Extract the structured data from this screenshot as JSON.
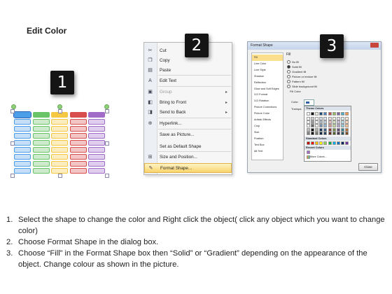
{
  "page": {
    "title": "Edit Color"
  },
  "badges": [
    "1",
    "2",
    "3"
  ],
  "table_shape": {
    "columns": [
      "#4d9ee8",
      "#69c367",
      "#f4c843",
      "#d84d4d",
      "#a06cc8"
    ],
    "rows": 9
  },
  "context_menu": {
    "items": [
      {
        "label": "Cut",
        "icon": "scissors-icon",
        "glyph": "✂",
        "disabled": false,
        "submenu": false,
        "highlighted": false
      },
      {
        "label": "Copy",
        "icon": "copy-icon",
        "glyph": "❐",
        "disabled": false,
        "submenu": false,
        "highlighted": false
      },
      {
        "label": "Paste",
        "icon": "paste-icon",
        "glyph": "▤",
        "disabled": false,
        "submenu": false,
        "highlighted": false
      },
      {
        "label": "Edit Text",
        "icon": "edit-text-icon",
        "glyph": "A",
        "disabled": false,
        "submenu": false,
        "highlighted": false
      },
      {
        "label": "Group",
        "icon": "group-icon",
        "glyph": "▣",
        "disabled": true,
        "submenu": true,
        "highlighted": false
      },
      {
        "label": "Bring to Front",
        "icon": "bring-to-front-icon",
        "glyph": "◧",
        "disabled": false,
        "submenu": true,
        "highlighted": false
      },
      {
        "label": "Send to Back",
        "icon": "send-to-back-icon",
        "glyph": "◨",
        "disabled": false,
        "submenu": true,
        "highlighted": false
      },
      {
        "label": "Hyperlink...",
        "icon": "hyperlink-icon",
        "glyph": "⊕",
        "disabled": false,
        "submenu": false,
        "highlighted": false
      },
      {
        "label": "Save as Picture...",
        "icon": "",
        "glyph": "",
        "disabled": false,
        "submenu": false,
        "highlighted": false
      },
      {
        "label": "Set as Default Shape",
        "icon": "",
        "glyph": "",
        "disabled": false,
        "submenu": false,
        "highlighted": false
      },
      {
        "label": "Size and Position...",
        "icon": "size-position-icon",
        "glyph": "⊞",
        "disabled": false,
        "submenu": false,
        "highlighted": false
      },
      {
        "label": "Format Shape...",
        "icon": "format-shape-icon",
        "glyph": "✎",
        "disabled": false,
        "submenu": false,
        "highlighted": true
      }
    ]
  },
  "format_dialog": {
    "title": "Format Shape",
    "nav": [
      "Fill",
      "Line Color",
      "Line Style",
      "Shadow",
      "Reflection",
      "Glow and Soft Edges",
      "3-D Format",
      "3-D Rotation",
      "Picture Corrections",
      "Picture Color",
      "Artistic Effects",
      "Crop",
      "Size",
      "Position",
      "Text Box",
      "Alt Text"
    ],
    "selected_nav": "Fill",
    "section_title": "Fill",
    "options": [
      {
        "label": "No fill",
        "selected": false
      },
      {
        "label": "Solid fill",
        "selected": true
      },
      {
        "label": "Gradient fill",
        "selected": false
      },
      {
        "label": "Picture or texture fill",
        "selected": false
      },
      {
        "label": "Pattern fill",
        "selected": false
      },
      {
        "label": "Slide background fill",
        "selected": false
      }
    ],
    "fill_color_label": "Fill Color",
    "color_label": "Color:",
    "transparency_label": "Transpa",
    "theme_colors_label": "Theme Colors",
    "standard_colors_label": "Standard Colors",
    "recent_colors_label": "Recent Colors",
    "more_colors_label": "More Colors...",
    "close_label": "Close",
    "theme_top_row": [
      "#ffffff",
      "#000000",
      "#eeece1",
      "#1f497d",
      "#4f81bd",
      "#c0504d",
      "#9bbb59",
      "#8064a2",
      "#4bacc6",
      "#f79646"
    ],
    "standard_colors": [
      "#c00000",
      "#ff0000",
      "#ffc000",
      "#ffff00",
      "#92d050",
      "#00b050",
      "#00b0f0",
      "#0070c0",
      "#002060",
      "#7030a0"
    ],
    "recent_colors": [
      "#a06cc8"
    ]
  },
  "instructions": [
    {
      "num": "1.",
      "text": "Select the shape to change the color and Right click the object( click any object which you want to change color)"
    },
    {
      "num": "2.",
      "text": "Choose Format Shape in the dialog box."
    },
    {
      "num": "3.",
      "text": "Choose “Fill” in the Format Shape box then “Solid” or “Gradient” depending on the appearance of the object. Change colour as shown in the picture."
    }
  ]
}
